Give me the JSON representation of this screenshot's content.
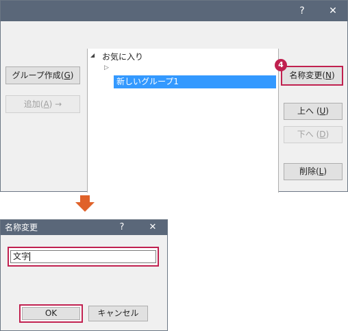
{
  "main_dialog": {
    "title_buttons": {
      "help": "?",
      "close": "✕"
    },
    "left_buttons": {
      "create_group_text": "グループ作成(",
      "create_group_key": "G",
      "create_group_end": ")",
      "add_text": "追加(",
      "add_key": "A",
      "add_end": ")  →"
    },
    "tree": {
      "root_label": "お気に入り",
      "root_expander": "◢",
      "child_expander": "▷",
      "selected_item": "新しいグループ1"
    },
    "right_buttons": {
      "rename_text": "名称変更(",
      "rename_key": "N",
      "rename_end": ")",
      "up_text": "上へ (",
      "up_key": "U",
      "up_end": ")",
      "down_text": "下へ (",
      "down_key": "D",
      "down_end": ")",
      "delete_text": "削除(",
      "delete_key": "L",
      "delete_end": ")"
    },
    "step_badge": "4"
  },
  "rename_dialog": {
    "title": "名称変更",
    "title_buttons": {
      "help": "?",
      "close": "✕"
    },
    "name_input_value": "文字",
    "ok_label": "OK",
    "cancel_label": "キャンセル"
  },
  "colors": {
    "highlight": "#c0204f",
    "titlebar": "#5a6779",
    "selection": "#3399ff",
    "arrow": "#e0622a"
  }
}
